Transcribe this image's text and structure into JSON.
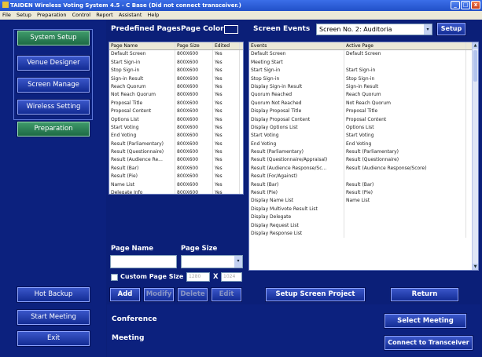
{
  "window": {
    "title": "TAIDEN Wireless Voting System 4.5 - C Base (Did not connect transceiver.)",
    "min": "_",
    "max": "□",
    "close": "x"
  },
  "menu": [
    "File",
    "Setup",
    "Preparation",
    "Control",
    "Report",
    "Assistant",
    "Help"
  ],
  "sidebar": {
    "system_setup": "System Setup",
    "venue_designer": "Venue Designer",
    "screen_manage": "Screen Manage",
    "wireless_setting": "Wireless Setting",
    "preparation": "Preparation",
    "hot_backup": "Hot Backup",
    "start_meeting": "Start Meeting",
    "exit": "Exit"
  },
  "predefined": {
    "title": "Predefined Pages",
    "page_color_label": "Page Color",
    "columns": [
      "Page Name",
      "Page Size",
      "Edited"
    ],
    "rows": [
      [
        "Default Screen",
        "800X600",
        "Yes"
      ],
      [
        "Start Sign-in",
        "800X600",
        "Yes"
      ],
      [
        "Stop Sign-in",
        "800X600",
        "Yes"
      ],
      [
        "Sign-in Result",
        "800X600",
        "Yes"
      ],
      [
        "Reach Quorum",
        "800X600",
        "Yes"
      ],
      [
        "Not Reach Quorum",
        "800X600",
        "Yes"
      ],
      [
        "Proposal Title",
        "800X600",
        "Yes"
      ],
      [
        "Proposal Content",
        "800X600",
        "Yes"
      ],
      [
        "Options List",
        "800X600",
        "Yes"
      ],
      [
        "Start Voting",
        "800X600",
        "Yes"
      ],
      [
        "End Voting",
        "800X600",
        "Yes"
      ],
      [
        "Result (Parliamentary)",
        "800X600",
        "Yes"
      ],
      [
        "Result (Questionnaire)",
        "800X600",
        "Yes"
      ],
      [
        "Result (Audience Re...",
        "800X600",
        "Yes"
      ],
      [
        "Result (Bar)",
        "800X600",
        "Yes"
      ],
      [
        "Result (Pie)",
        "800X600",
        "Yes"
      ],
      [
        "Name List",
        "800X600",
        "Yes"
      ],
      [
        "Delegate Info",
        "800X600",
        "Yes"
      ]
    ],
    "page_name_label": "Page Name",
    "page_size_label": "Page Size",
    "custom_label": "Custom Page Size",
    "width": "1280",
    "height": "1024",
    "x": "X",
    "add": "Add",
    "modify": "Modify",
    "delete": "Delete",
    "edit": "Edit"
  },
  "events": {
    "title": "Screen Events",
    "screen_select": "Screen No. 2: Auditoria",
    "setup": "Setup",
    "columns": [
      "Events",
      "Active Page"
    ],
    "rows": [
      [
        "Default Screen",
        "Default Screen"
      ],
      [
        "Meeting Start",
        ""
      ],
      [
        "Start Sign-in",
        "Start Sign-in"
      ],
      [
        "Stop Sign-in",
        "Stop Sign-in"
      ],
      [
        "Display Sign-in Result",
        "Sign-in Result"
      ],
      [
        "Quorum Reached",
        "Reach Quorum"
      ],
      [
        "Quorum Not Reached",
        "Not Reach Quorum"
      ],
      [
        "Display Proposal Title",
        "Proposal Title"
      ],
      [
        "Display Proposal Content",
        "Proposal Content"
      ],
      [
        "Display Options List",
        "Options List"
      ],
      [
        "Start Voting",
        "Start Voting"
      ],
      [
        "End Voting",
        "End Voting"
      ],
      [
        "Result (Parliamentary)",
        "Result (Parliamentary)"
      ],
      [
        "Result (Questionnaire/Appraisal)",
        "Result (Questionnaire)"
      ],
      [
        "Result (Audience Response/Sc...",
        "Result (Audience Response/Score)"
      ],
      [
        "Result (For/Against)",
        ""
      ],
      [
        "Result (Bar)",
        "Result (Bar)"
      ],
      [
        "Result (Pie)",
        "Result (Pie)"
      ],
      [
        "Display Name List",
        "Name List"
      ],
      [
        "Display Multivote Result List",
        ""
      ],
      [
        "Display Delegate",
        ""
      ],
      [
        "Display Request List",
        ""
      ],
      [
        "Display Response List",
        ""
      ]
    ],
    "setup_project": "Setup Screen Project",
    "return": "Return"
  },
  "bottom": {
    "conference": "Conference",
    "meeting": "Meeting",
    "select_meeting": "Select Meeting",
    "connect": "Connect to Transceiver"
  }
}
